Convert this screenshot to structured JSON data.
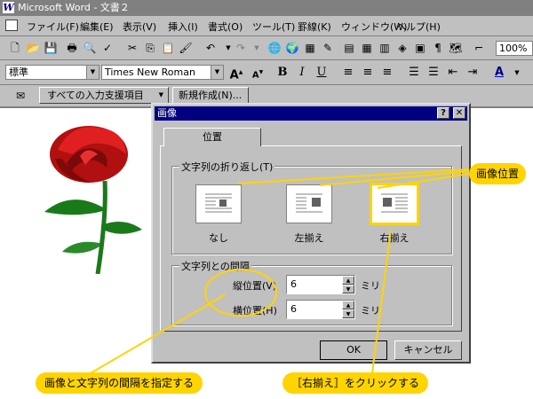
{
  "app": {
    "title": "Microsoft Word - 文書２"
  },
  "menu": [
    {
      "label": "ファイル(F)"
    },
    {
      "label": "編集(E)"
    },
    {
      "label": "表示(V)"
    },
    {
      "label": "挿入(I)"
    },
    {
      "label": "書式(O)"
    },
    {
      "label": "ツール(T)"
    },
    {
      "label": "罫線(K)"
    },
    {
      "label": "ウィンドウ(W)"
    },
    {
      "label": "ヘルプ(H)"
    }
  ],
  "toolbar": {
    "zoom": "100%"
  },
  "format": {
    "style": "標準",
    "font": "Times New Roman",
    "bold": "B",
    "italic": "I",
    "underline": "U"
  },
  "input_bar": {
    "assist_label": "すべての入力支援項目",
    "new_label": "新規作成(N)..."
  },
  "dialog": {
    "title": "画像",
    "help_btn": "?",
    "close_btn": "✕",
    "tab": "位置",
    "wrap_group": "文字列の折り返し(T)",
    "wrap_options": [
      {
        "label": "なし"
      },
      {
        "label": "左揃え"
      },
      {
        "label": "右揃え"
      }
    ],
    "spacing_group": "文字列との間隔",
    "vertical": {
      "label": "縦位置(V)",
      "value": "6",
      "unit": "ミリ"
    },
    "horizontal": {
      "label": "横位置(H)",
      "value": "6",
      "unit": "ミリ"
    },
    "ok": "OK",
    "cancel": "キャンセル"
  },
  "callouts": {
    "image_position": "画像位置",
    "spacing_note": "画像と文字列の間隔を指定する",
    "right_note": "［右揃え］をクリックする"
  },
  "colors": {
    "callout": "#ffd400",
    "title_active": "#000080",
    "title_inactive": "#808080",
    "rose": "#b01010",
    "stem": "#1a7a1a"
  }
}
